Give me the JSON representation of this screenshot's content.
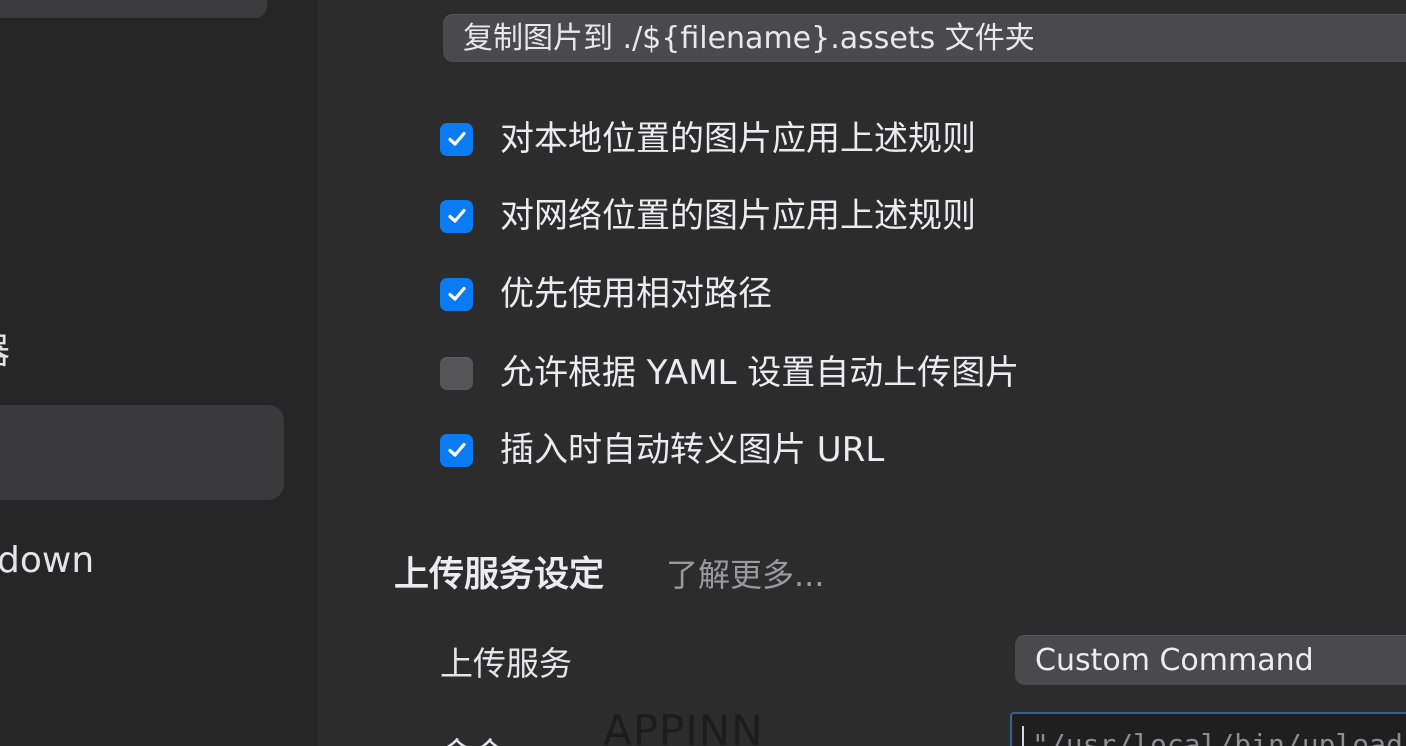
{
  "sidebar": {
    "partial_item_top": "器",
    "partial_item_markdown": "down"
  },
  "image_settings": {
    "copy_action_value": "复制图片到 ./${filename}.assets 文件夹",
    "options": [
      {
        "label": "对本地位置的图片应用上述规则",
        "checked": true
      },
      {
        "label": "对网络位置的图片应用上述规则",
        "checked": true
      },
      {
        "label": "优先使用相对路径",
        "checked": true
      },
      {
        "label": "允许根据 YAML 设置自动上传图片",
        "checked": false
      },
      {
        "label": "插入时自动转义图片 URL",
        "checked": true
      }
    ]
  },
  "upload": {
    "section_title": "上传服务设定",
    "learn_more": "了解更多...",
    "service_label": "上传服务",
    "service_value": "Custom Command",
    "command_label": "命令",
    "command_value": "\"/usr/local/bin/upload-image\""
  },
  "watermark": "APPINN",
  "colors": {
    "accent": "#0a7bf2",
    "background": "#2c2c2d",
    "sidebar": "#262627"
  }
}
